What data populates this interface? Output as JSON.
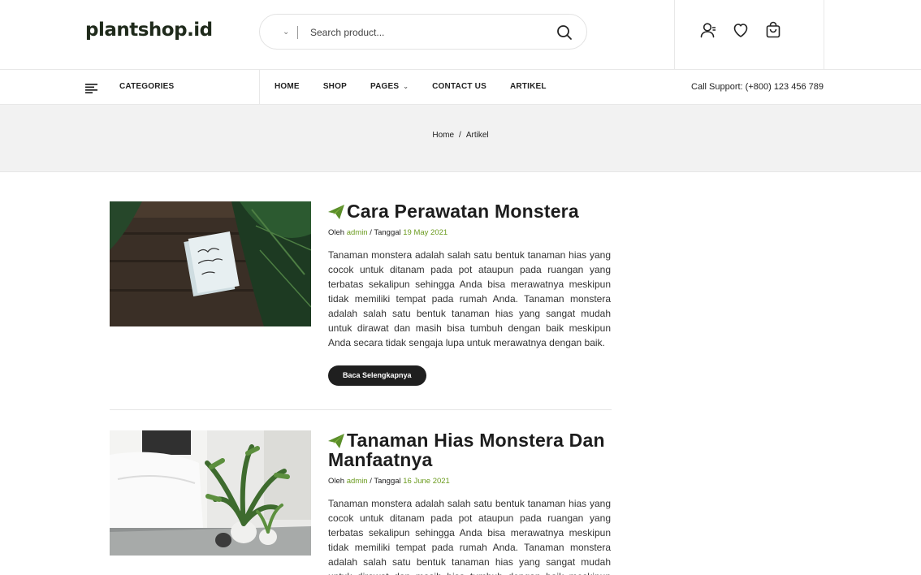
{
  "header": {
    "logo": "plantshop.id",
    "search_placeholder": "Search product..."
  },
  "nav": {
    "categories_label": "CATEGORIES",
    "menu": [
      {
        "label": "HOME"
      },
      {
        "label": "SHOP"
      },
      {
        "label": "PAGES"
      },
      {
        "label": "CONTACT US"
      },
      {
        "label": "ARTIKEL"
      }
    ],
    "support": "Call Support: (+800) 123 456 789"
  },
  "breadcrumb": {
    "home": "Home",
    "separator": "/",
    "current": "Artikel"
  },
  "posts": [
    {
      "title": "Cara Perawatan Monstera",
      "by_label": "Oleh",
      "author": "admin",
      "date_label": "/ Tanggal",
      "date": "19 May 2021",
      "excerpt": "Tanaman monstera adalah salah satu bentuk tanaman hias yang cocok untuk ditanam pada pot ataupun pada ruangan yang terbatas sekalipun sehingga Anda bisa merawatnya meskipun tidak memiliki tempat pada rumah Anda. Tanaman monstera adalah salah satu bentuk tanaman hias yang sangat mudah untuk dirawat dan masih bisa tumbuh dengan baik meskipun Anda secara tidak sengaja lupa untuk merawatnya dengan baik.",
      "button": "Baca Selengkapnya"
    },
    {
      "title": "Tanaman Hias Monstera Dan Manfaatnya",
      "by_label": "Oleh",
      "author": "admin",
      "date_label": "/ Tanggal",
      "date": "16 June 2021",
      "excerpt": "Tanaman monstera adalah salah satu bentuk tanaman hias yang cocok untuk ditanam pada pot ataupun pada ruangan yang terbatas sekalipun sehingga Anda bisa merawatnya meskipun tidak memiliki tempat pada rumah Anda. Tanaman monstera adalah salah satu bentuk tanaman hias yang sangat mudah untuk dirawat dan masih bisa tumbuh dengan baik meskipun Anda secara tidak sengaja lupa untuk merawatnya dengan baik."
    }
  ],
  "colors": {
    "accent": "#6b9b1f",
    "dark": "#1f1f1f"
  }
}
